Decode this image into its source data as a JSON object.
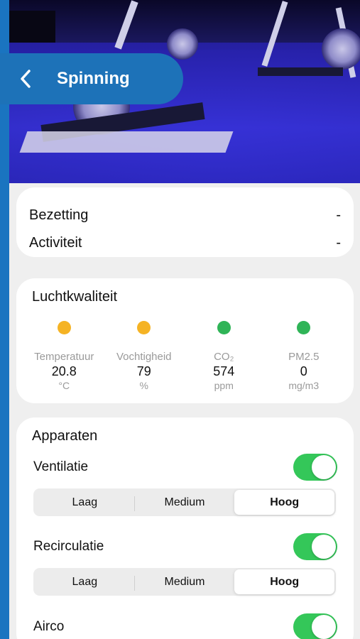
{
  "header": {
    "title": "Spinning",
    "back_icon": "chevron-left-icon"
  },
  "occupancy": {
    "rows": [
      {
        "label": "Bezetting",
        "value": "-"
      },
      {
        "label": "Activiteit",
        "value": "-"
      }
    ]
  },
  "air_quality": {
    "title": "Luchtkwaliteit",
    "metrics": [
      {
        "label": "Temperatuur",
        "value": "20.8",
        "unit": "°C",
        "status_color": "#f5b324"
      },
      {
        "label": "Vochtigheid",
        "value": "79",
        "unit": "%",
        "status_color": "#f5b324"
      },
      {
        "label": "CO₂",
        "value": "574",
        "unit": "ppm",
        "status_color": "#2fb457"
      },
      {
        "label": "PM2.5",
        "value": "0",
        "unit": "mg/m3",
        "status_color": "#2fb457"
      }
    ]
  },
  "devices": {
    "title": "Apparaten",
    "items": [
      {
        "name": "Ventilatie",
        "enabled": true,
        "options": [
          "Laag",
          "Medium",
          "Hoog"
        ],
        "selected": "Hoog"
      },
      {
        "name": "Recirculatie",
        "enabled": true,
        "options": [
          "Laag",
          "Medium",
          "Hoog"
        ],
        "selected": "Hoog"
      },
      {
        "name": "Airco",
        "enabled": true
      }
    ]
  },
  "colors": {
    "accent": "#1d72b8",
    "toggle_on": "#34c759"
  }
}
